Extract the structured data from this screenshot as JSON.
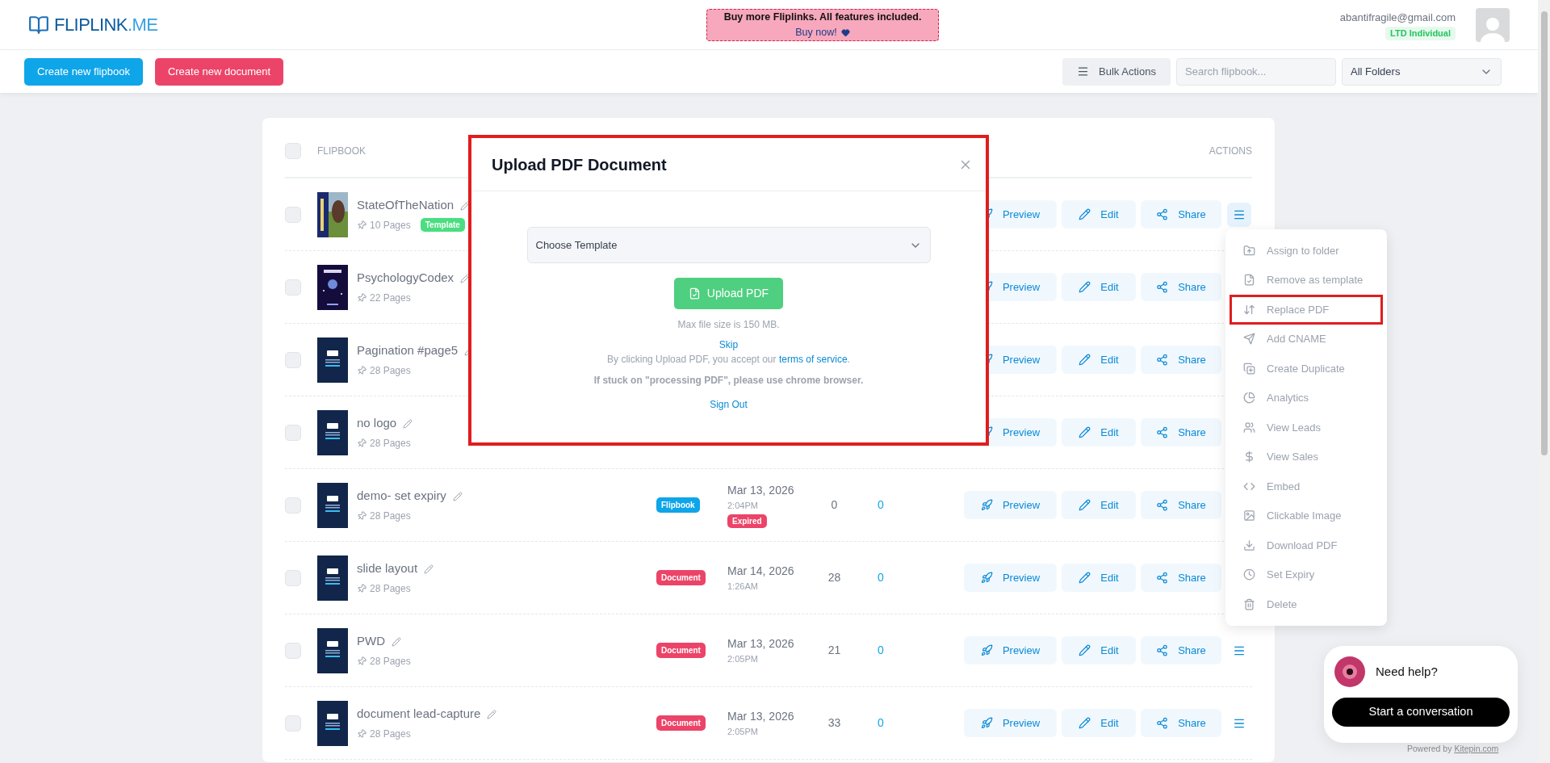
{
  "brand": {
    "name": "FLIPLINK",
    "suffix": ".ME"
  },
  "promo": {
    "title": "Buy more Fliplinks. All features included.",
    "link": "Buy now!"
  },
  "account": {
    "email": "abantifragile@gmail.com",
    "plan": "LTD Individual"
  },
  "toolbar": {
    "primary": "Create new flipbook",
    "secondary": "Create new document",
    "bulk": "Bulk Actions",
    "search_placeholder": "Search flipbook...",
    "folder": "All Folders"
  },
  "table": {
    "select_all_checked": false,
    "columns": [
      "FLIPBOOK",
      "ACTIONS"
    ],
    "rows": [
      {
        "title": "StateOfTheNation",
        "pages": "10 Pages",
        "badge": "Template",
        "checked": false,
        "actions": [
          "Preview",
          "Edit",
          "Share"
        ],
        "menu": {
          "active": true
        }
      },
      {
        "title": "PsychologyCodex",
        "pages": "22 Pages",
        "checked": false,
        "actions": [
          "Preview",
          "Edit",
          "Share"
        ]
      },
      {
        "title": "Pagination #page5",
        "pages": "28 Pages",
        "checked": false,
        "actions": [
          "Preview",
          "Edit",
          "Share"
        ]
      },
      {
        "title": "no logo",
        "pages": "28 Pages",
        "checked": false,
        "actions": [
          "Preview",
          "Edit",
          "Share"
        ]
      },
      {
        "title": "demo- set expiry",
        "pages": "28 Pages",
        "checked": false,
        "type": {
          "label": "Flipbook",
          "kind": "flipbook"
        },
        "date": "Mar 13, 2026",
        "time": "2:04PM",
        "expired": "Expired",
        "count": "0",
        "leads": "0",
        "actions": [
          "Preview",
          "Edit",
          "Share"
        ]
      },
      {
        "title": "slide layout",
        "pages": "28 Pages",
        "checked": false,
        "type": {
          "label": "Document",
          "kind": "document"
        },
        "date": "Mar 14, 2026",
        "time": "1:26AM",
        "count": "28",
        "leads": "0",
        "actions": [
          "Preview",
          "Edit",
          "Share"
        ]
      },
      {
        "title": "PWD",
        "pages": "28 Pages",
        "checked": false,
        "type": {
          "label": "Document",
          "kind": "document"
        },
        "date": "Mar 13, 2026",
        "time": "2:05PM",
        "count": "21",
        "leads": "0",
        "actions": [
          "Preview",
          "Edit",
          "Share"
        ],
        "menu": {
          "active": false
        }
      },
      {
        "title": "document lead-capture",
        "pages": "28 Pages",
        "checked": false,
        "type": {
          "label": "Document",
          "kind": "document"
        },
        "date": "Mar 13, 2026",
        "time": "2:05PM",
        "count": "33",
        "leads": "0",
        "actions": [
          "Preview",
          "Edit",
          "Share"
        ],
        "menu": {
          "active": false
        }
      }
    ]
  },
  "row_menu": {
    "items": [
      {
        "label": "Assign to folder",
        "highlighted": false
      },
      {
        "label": "Remove as template",
        "highlighted": false
      },
      {
        "label": "Replace PDF",
        "highlighted": true
      },
      {
        "label": "Add CNAME",
        "highlighted": false
      },
      {
        "label": "Create Duplicate",
        "highlighted": false
      },
      {
        "label": "Analytics",
        "highlighted": false
      },
      {
        "label": "View Leads",
        "highlighted": false
      },
      {
        "label": "View Sales",
        "highlighted": false
      },
      {
        "label": "Embed",
        "highlighted": false
      },
      {
        "label": "Clickable Image",
        "highlighted": false
      },
      {
        "label": "Download PDF",
        "highlighted": false
      },
      {
        "label": "Set Expiry",
        "highlighted": false
      },
      {
        "label": "Delete",
        "highlighted": false
      }
    ]
  },
  "dialog": {
    "title": "Upload PDF Document",
    "select_placeholder": "Choose Template",
    "upload": "Upload PDF",
    "size_note": "Max file size is 150 MB.",
    "skip": "Skip",
    "terms_prefix": "By clicking Upload PDF, you accept our",
    "terms_link": "terms of service",
    "terms_suffix": ".",
    "browser_note": "If stuck on \"processing PDF\", please use chrome browser.",
    "sign_out": "Sign Out"
  },
  "chat": {
    "question": "Need help?",
    "button": "Start a conversation",
    "powered_prefix": "Powered by",
    "powered_link": "Kitepin.com"
  }
}
